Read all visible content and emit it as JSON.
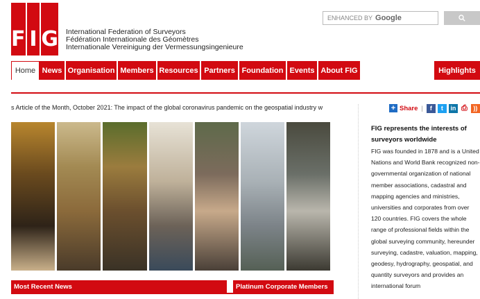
{
  "logo": {
    "letters": [
      "F",
      "I",
      "G"
    ]
  },
  "org_names": [
    "International Federation of Surveyors",
    "Fédération Internationale des Géomètres",
    "Internationale Vereinigung der Vermessungsingenieure"
  ],
  "search": {
    "prefix": "ENHANCED BY",
    "brand": "Google",
    "button_icon": "search-icon"
  },
  "nav": {
    "items": [
      "Home",
      "News",
      "Organisation",
      "Members",
      "Resources",
      "Partners",
      "Foundation",
      "Events",
      "About FIG"
    ],
    "highlights": "Highlights",
    "active": "Home"
  },
  "ticker": "s Article of the Month, October 2021: The impact of the global coronavirus pandemic on the geospatial industry w",
  "sections": {
    "news": "Most Recent News",
    "platinum": "Platinum Corporate Members"
  },
  "sidebar": {
    "share_label": "Share",
    "social_icons": [
      "facebook-icon",
      "twitter-icon",
      "linkedin-icon",
      "print-icon",
      "rss-icon"
    ],
    "title": "FIG represents the interests of surveyors worldwide",
    "text": "FIG was founded in 1878 and is a United Nations and World Bank recognized non-governmental organization of national member associations, cadastral and mapping agencies and ministries, universities and corporates from over 120 countries. FIG covers the whole range of professional fields within the global surveying community, hereunder surveying, cadastre, valuation, mapping, geodesy, hydrography, geospatial, and quantity surveyors and provides an international forum"
  },
  "colors": {
    "brand": "#d20a11"
  }
}
